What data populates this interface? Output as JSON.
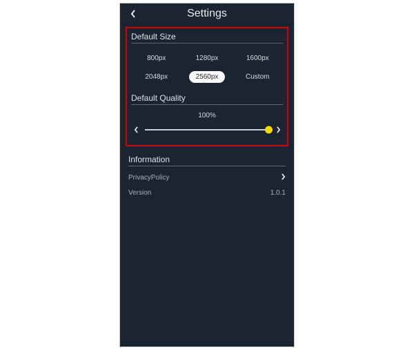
{
  "header": {
    "title": "Settings"
  },
  "defaultSize": {
    "title": "Default Size",
    "options": {
      "o0": "800px",
      "o1": "1280px",
      "o2": "1600px",
      "o3": "2048px",
      "o4": "2560px",
      "o5": "Custom"
    },
    "selected": "o4"
  },
  "defaultQuality": {
    "title": "Default Quality",
    "value": "100%",
    "percent": 100
  },
  "information": {
    "title": "Information",
    "privacy_label": "PrivacyPolicy",
    "version_label": "Version",
    "version_value": "1.0.1"
  }
}
